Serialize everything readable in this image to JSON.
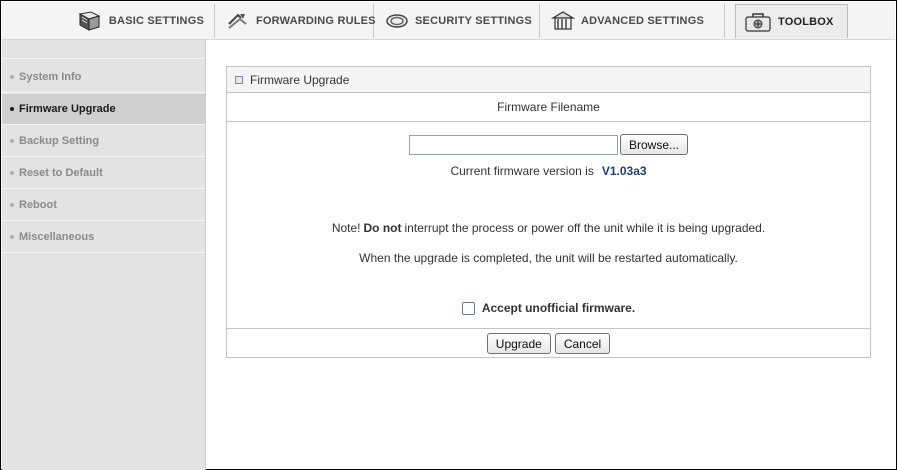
{
  "nav": {
    "tabs": [
      {
        "label": "BASIC SETTINGS",
        "icon": "document-icon"
      },
      {
        "label": "FORWARDING RULES",
        "icon": "forward-arrows-icon"
      },
      {
        "label": "SECURITY SETTINGS",
        "icon": "shield-icon"
      },
      {
        "label": "ADVANCED SETTINGS",
        "icon": "building-icon"
      },
      {
        "label": "TOOLBOX",
        "icon": "toolbox-icon",
        "active": true
      }
    ]
  },
  "sidebar": {
    "items": [
      {
        "label": "System Info"
      },
      {
        "label": "Firmware Upgrade",
        "active": true
      },
      {
        "label": "Backup Setting"
      },
      {
        "label": "Reset to Default"
      },
      {
        "label": "Reboot"
      },
      {
        "label": "Miscellaneous"
      }
    ]
  },
  "panel": {
    "title": "Firmware Upgrade",
    "section_title": "Firmware Filename",
    "file_input_value": "",
    "browse_label": "Browse...",
    "version_prefix": "Current firmware version is",
    "version": "V1.03a3",
    "note_prefix": "Note!",
    "note_bold": "Do not",
    "note_rest": "interrupt the process or power off the unit while it is being upgraded.",
    "note2": "When the upgrade is completed, the unit will be restarted automatically.",
    "checkbox_label": "Accept unofficial firmware.",
    "checkbox_checked": false,
    "upgrade_label": "Upgrade",
    "cancel_label": "Cancel"
  },
  "colors": {
    "version_text": "#1d3f79",
    "sidebar_bg": "#e3e3e3",
    "active_sidebar_bg": "#cfcfcf"
  }
}
